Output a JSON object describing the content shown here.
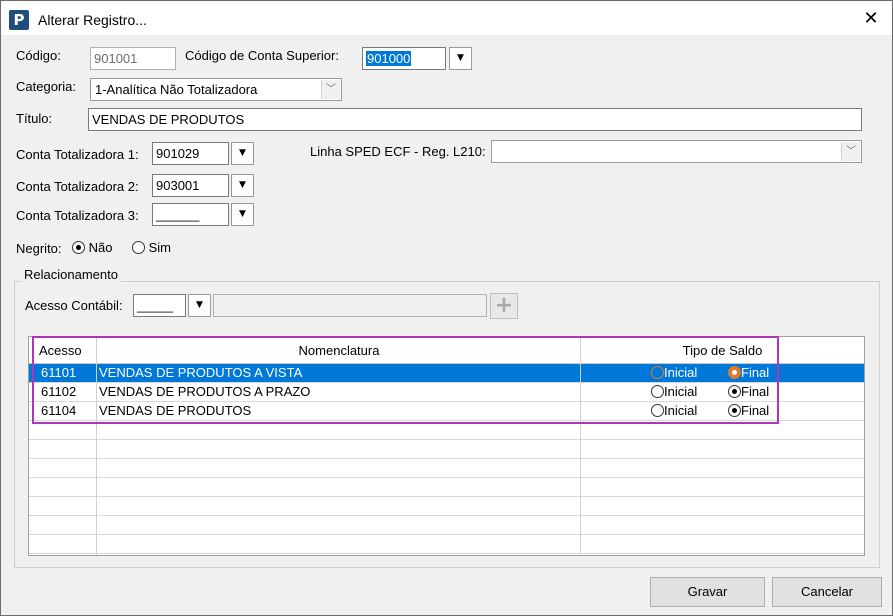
{
  "window": {
    "title": "Alterar Registro...",
    "icon": "P"
  },
  "form": {
    "codigo_label": "Código:",
    "codigo_value": "901001",
    "conta_superior_label": "Código de Conta Superior:",
    "conta_superior_value": "901000",
    "categoria_label": "Categoria:",
    "categoria_value": "1-Analítica Não Totalizadora",
    "titulo_label": "Título:",
    "titulo_value": "VENDAS DE PRODUTOS",
    "ct1_label": "Conta Totalizadora 1:",
    "ct1_value": "901029",
    "ct2_label": "Conta Totalizadora 2:",
    "ct2_value": "903001",
    "ct3_label": "Conta Totalizadora 3:",
    "ct3_value": "______",
    "sped_label": "Linha SPED ECF - Reg. L210:",
    "sped_value": "",
    "negrito_label": "Negrito:",
    "negrito_nao": "Não",
    "negrito_sim": "Sim"
  },
  "relacionamento": {
    "title": "Relacionamento",
    "acesso_label": "Acesso Contábil:",
    "acesso_value": "_____",
    "desc_value": ""
  },
  "grid": {
    "columns": [
      "Acesso",
      "Nomenclatura",
      "Tipo de Saldo"
    ],
    "radio_inicial": "Inicial",
    "radio_final": "Final",
    "rows": [
      {
        "acesso": "61101",
        "nome": "VENDAS DE PRODUTOS A VISTA",
        "saldo": "Final"
      },
      {
        "acesso": "61102",
        "nome": "VENDAS DE PRODUTOS A PRAZO",
        "saldo": "Final"
      },
      {
        "acesso": "61104",
        "nome": "VENDAS DE PRODUTOS",
        "saldo": "Final"
      }
    ]
  },
  "buttons": {
    "gravar": "Gravar",
    "cancelar": "Cancelar"
  },
  "colors": {
    "selection": "#0078d7",
    "highlight_box": "#b036b8",
    "radio_accent": "#e07a2b"
  }
}
